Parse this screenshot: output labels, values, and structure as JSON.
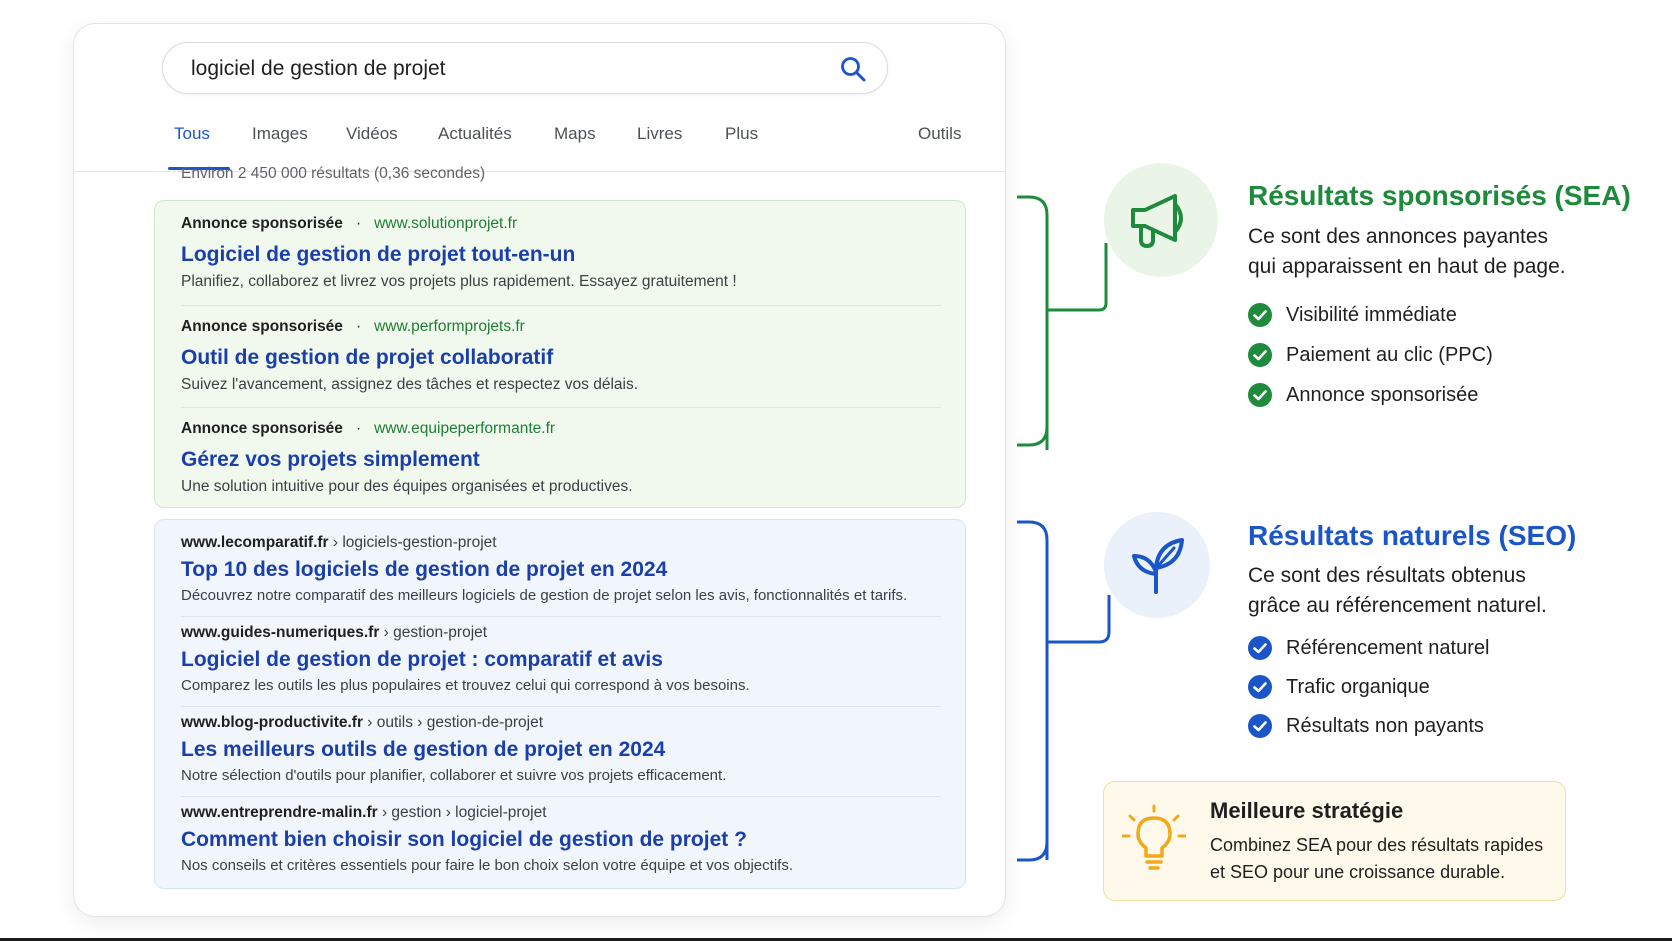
{
  "search": {
    "query": "logiciel de gestion de projet",
    "tabs": [
      {
        "label": "Tous",
        "active": true
      },
      {
        "label": "Images"
      },
      {
        "label": "Vidéos"
      },
      {
        "label": "Actualités"
      },
      {
        "label": "Maps"
      },
      {
        "label": "Livres"
      },
      {
        "label": "Plus"
      },
      {
        "label": "Outils"
      }
    ],
    "result_count": "Environ 2 450 000 résultats (0,36 secondes)"
  },
  "ads": [
    {
      "label": "Annonce sponsorisée",
      "separator": "·",
      "url": "www.solutionprojet.fr",
      "title": "Logiciel de gestion de projet tout-en-un",
      "description": "Planifiez, collaborez et livrez vos projets plus rapidement. Essayez gratuitement !"
    },
    {
      "label": "Annonce sponsorisée",
      "separator": "·",
      "url": "www.performprojets.fr",
      "title": "Outil de gestion de projet collaboratif",
      "description": "Suivez l'avancement, assignez des tâches et respectez vos délais."
    },
    {
      "label": "Annonce sponsorisée",
      "separator": "·",
      "url": "www.equipeperformante.fr",
      "title": "Gérez vos projets simplement",
      "description": "Une solution intuitive pour des équipes organisées et productives."
    }
  ],
  "organic": [
    {
      "domain": "www.lecomparatif.fr",
      "path": " › logiciels-gestion-projet",
      "title": "Top 10 des logiciels de gestion de projet en 2024",
      "description": "Découvrez notre comparatif des meilleurs logiciels de gestion de projet selon les avis, fonctionnalités et tarifs."
    },
    {
      "domain": "www.guides-numeriques.fr",
      "path": " › gestion-projet",
      "title": "Logiciel de gestion de projet : comparatif et avis",
      "description": "Comparez les outils les plus populaires et trouvez celui qui correspond à vos besoins."
    },
    {
      "domain": "www.blog-productivite.fr",
      "path": " › outils › gestion-de-projet",
      "title": "Les meilleurs outils de gestion de projet en 2024",
      "description": "Notre sélection d'outils pour planifier, collaborer et suivre vos projets efficacement."
    },
    {
      "domain": "www.entreprendre-malin.fr",
      "path": " › gestion › logiciel-projet",
      "title": "Comment bien choisir son logiciel de gestion de projet ?",
      "description": "Nos conseils et critères essentiels pour faire le bon choix selon votre équipe et vos objectifs."
    }
  ],
  "sea": {
    "title": "Résultats sponsorisés (SEA)",
    "desc_line1": "Ce sont des annonces payantes",
    "desc_line2": "qui apparaissent en haut de page.",
    "points": [
      "Visibilité immédiate",
      "Paiement au clic (PPC)",
      "Annonce sponsorisée"
    ],
    "color": "#1e8a3c",
    "icon": "megaphone-icon"
  },
  "seo": {
    "title": "Résultats naturels (SEO)",
    "desc_line1": "Ce sont des résultats obtenus",
    "desc_line2": "grâce au référencement naturel.",
    "points": [
      "Référencement naturel",
      "Trafic organique",
      "Résultats non payants"
    ],
    "color": "#1a56c8",
    "icon": "sprout-icon"
  },
  "strategy": {
    "title": "Meilleure stratégie",
    "desc_line1": "Combinez SEA pour des résultats rapides",
    "desc_line2": "et SEO pour une croissance durable.",
    "icon": "lightbulb-icon"
  }
}
